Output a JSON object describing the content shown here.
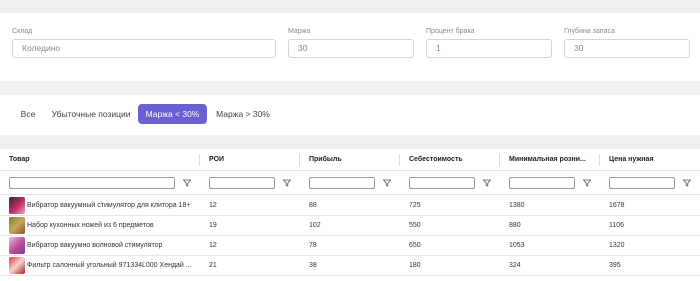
{
  "filters": {
    "warehouse": {
      "label": "Склад",
      "value": "Коледино"
    },
    "margin": {
      "label": "Маржа",
      "value": "30"
    },
    "defect_percent": {
      "label": "Процент брака",
      "value": "1"
    },
    "stock_depth": {
      "label": "Глубина запаса",
      "value": "30"
    }
  },
  "tabs": [
    {
      "label": "Все",
      "active": false
    },
    {
      "label": "Убыточные позиции",
      "active": false
    },
    {
      "label": "Маржа < 30%",
      "active": true
    },
    {
      "label": "Маржа > 30%",
      "active": false
    }
  ],
  "colors": {
    "accent": "#6a5fd3",
    "background": "#f0f0f2"
  },
  "table": {
    "columns": [
      "Товар",
      "РОИ",
      "Прибыль",
      "Себестоимость",
      "Минимальная розни...",
      "Цена нужная"
    ],
    "filter_icon": "funnel-icon",
    "rows": [
      {
        "product": "Вибратор вакуумный стимулятор для клитора 18+",
        "roi": "12",
        "profit": "88",
        "cost": "725",
        "min_retail": "1380",
        "price": "1678"
      },
      {
        "product": "Набор кухонных ножей из 6 предметов",
        "roi": "19",
        "profit": "102",
        "cost": "550",
        "min_retail": "880",
        "price": "1106"
      },
      {
        "product": "Вибратор вакуумно волновой стимулятор",
        "roi": "12",
        "profit": "78",
        "cost": "650",
        "min_retail": "1053",
        "price": "1320"
      },
      {
        "product": "Фильтр салонный угольный 971334L000 Хендай ...",
        "roi": "21",
        "profit": "38",
        "cost": "180",
        "min_retail": "324",
        "price": "395"
      }
    ]
  }
}
